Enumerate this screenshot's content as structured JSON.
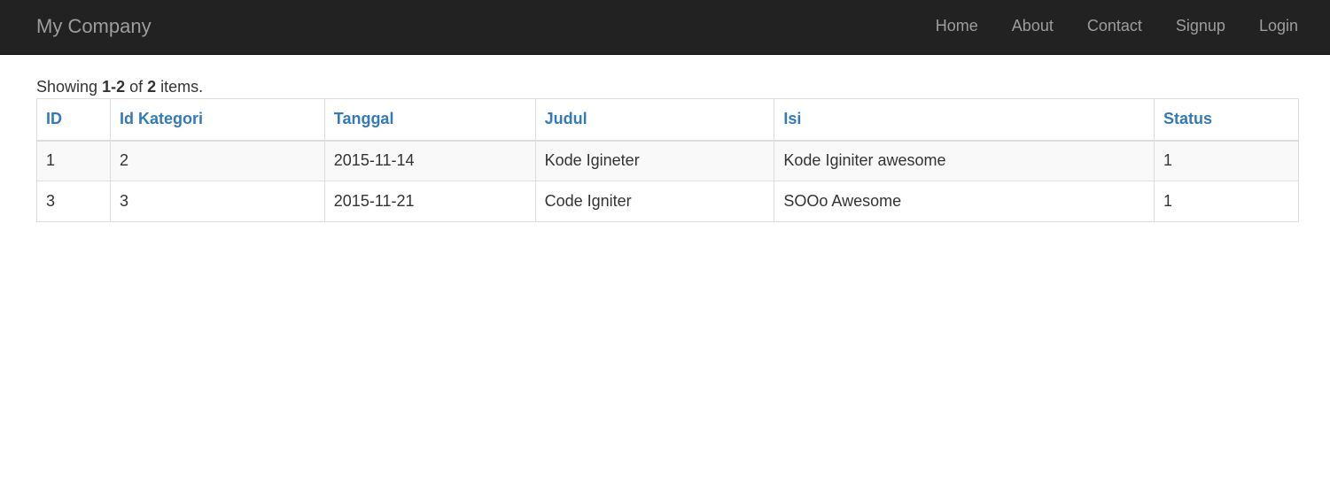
{
  "navbar": {
    "brand": "My Company",
    "items": [
      {
        "label": "Home"
      },
      {
        "label": "About"
      },
      {
        "label": "Contact"
      },
      {
        "label": "Signup"
      },
      {
        "label": "Login"
      }
    ]
  },
  "summary": {
    "prefix": "Showing ",
    "range": "1-2",
    "middle": " of ",
    "total": "2",
    "suffix": " items."
  },
  "table": {
    "columns": [
      "ID",
      "Id Kategori",
      "Tanggal",
      "Judul",
      "Isi",
      "Status"
    ],
    "rows": [
      [
        "1",
        "2",
        "2015-11-14",
        "Kode Igineter",
        "Kode Iginiter awesome",
        "1"
      ],
      [
        "3",
        "3",
        "2015-11-21",
        "Code Igniter",
        "SOOo Awesome",
        "1"
      ]
    ]
  },
  "colors": {
    "navbar_bg": "#222222",
    "nav_text": "#9d9d9d",
    "link": "#337ab7",
    "text": "#333333",
    "border": "#dddddd",
    "stripe": "#f9f9f9"
  }
}
